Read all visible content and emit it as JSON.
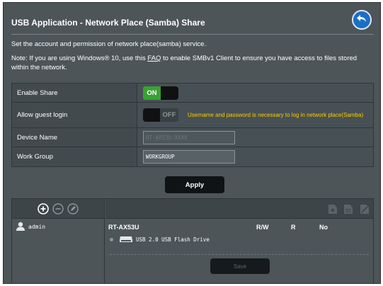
{
  "header": {
    "title": "USB Application - Network Place (Samba) Share"
  },
  "description": {
    "line1": "Set the account and permission of network place(samba) service.",
    "note_before": "Note: If you are using Windows® 10, use this ",
    "note_link": "FAQ",
    "note_after": " to enable SMBv1 Client to ensure you have access to files stored within the network."
  },
  "settings": {
    "enable_share": {
      "label": "Enable Share",
      "state": "ON"
    },
    "guest_login": {
      "label": "Allow guest login",
      "state": "OFF",
      "warning": "Username and password is necessary to log in network place(Samba)"
    },
    "device_name": {
      "label": "Device Name",
      "value": "RT-AX53U-XXXX"
    },
    "work_group": {
      "label": "Work Group",
      "value": "WORKGROUP"
    }
  },
  "buttons": {
    "apply": "Apply",
    "save": "Save"
  },
  "accounts": {
    "users": [
      {
        "name": "admin"
      }
    ],
    "device": "RT-AX53U",
    "permission_headers": [
      "R/W",
      "R",
      "No"
    ],
    "drive": "USB 2.0 USB Flash Drive"
  },
  "icons": {
    "back": "back-arrow-icon",
    "add": "add-account-icon",
    "remove": "remove-account-icon",
    "edit": "edit-account-icon",
    "new_folder": "new-folder-icon",
    "rename_folder": "rename-folder-icon",
    "delete_folder": "delete-folder-icon",
    "user": "user-icon",
    "drive": "usb-drive-icon"
  },
  "colors": {
    "background": "#4d5559",
    "toggle_on": "#39a233",
    "warning": "#ffcc00",
    "back_button": "#1b6fc4"
  }
}
